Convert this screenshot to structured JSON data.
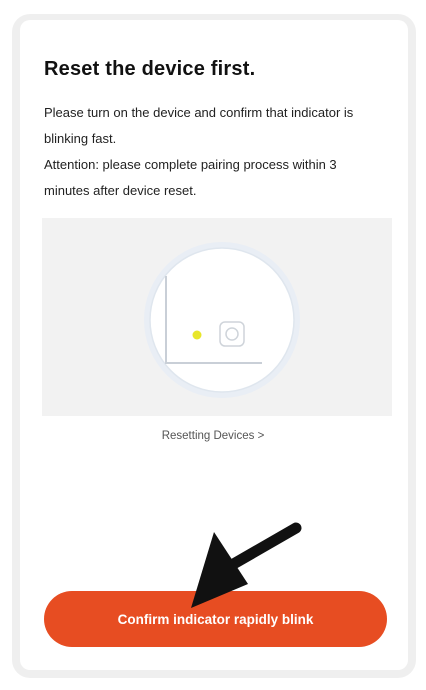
{
  "header": {
    "title": "Reset the device first."
  },
  "instructions": {
    "line1": "Please turn on the device and confirm that indicator is blinking fast.",
    "line2": "Attention: please complete pairing process within 3 minutes after device reset."
  },
  "illustration": {
    "icons": [
      "device-panel-illustration",
      "indicator-light-icon",
      "reset-button-icon"
    ],
    "indicator_color": "#e8e62a"
  },
  "links": {
    "resetting_devices": "Resetting Devices >"
  },
  "actions": {
    "confirm_label": "Confirm indicator rapidly blink"
  },
  "annotation": {
    "icons": [
      "pointer-arrow-icon"
    ]
  },
  "colors": {
    "accent": "#e74d22",
    "background": "#efefef"
  }
}
